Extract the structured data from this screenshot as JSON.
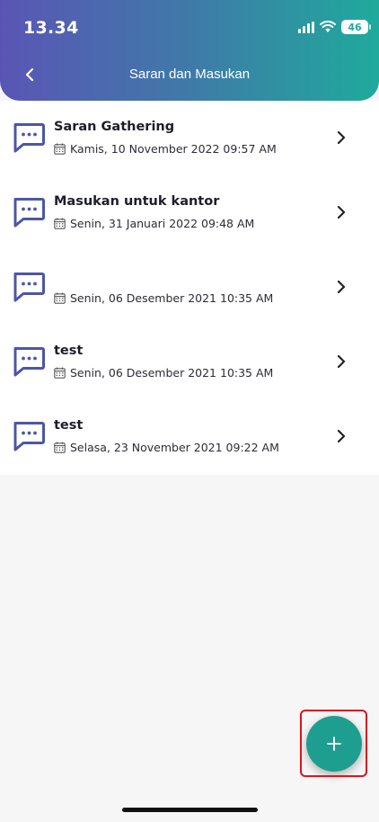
{
  "status_bar": {
    "time": "13.34",
    "battery": "46"
  },
  "header": {
    "title": "Saran dan Masukan",
    "back_icon": "chevron-left-icon"
  },
  "feedback_items": [
    {
      "title": "Saran Gathering",
      "date": "Kamis, 10 November 2022 09:57 AM"
    },
    {
      "title": "Masukan untuk kantor",
      "date": "Senin, 31 Januari 2022 09:48 AM"
    },
    {
      "title": "",
      "date": "Senin, 06 Desember 2021 10:35 AM"
    },
    {
      "title": "test",
      "date": "Senin, 06 Desember 2021 10:35 AM"
    },
    {
      "title": "test",
      "date": "Selasa, 23 November 2021 09:22 AM"
    }
  ],
  "fab": {
    "icon": "plus-icon",
    "label": "+"
  },
  "colors": {
    "header_gradient_start": "#5a55b5",
    "header_gradient_end": "#1faa9c",
    "message_icon": "#4c56a8",
    "fab": "#1e9e8f",
    "highlight": "#e0131a"
  }
}
